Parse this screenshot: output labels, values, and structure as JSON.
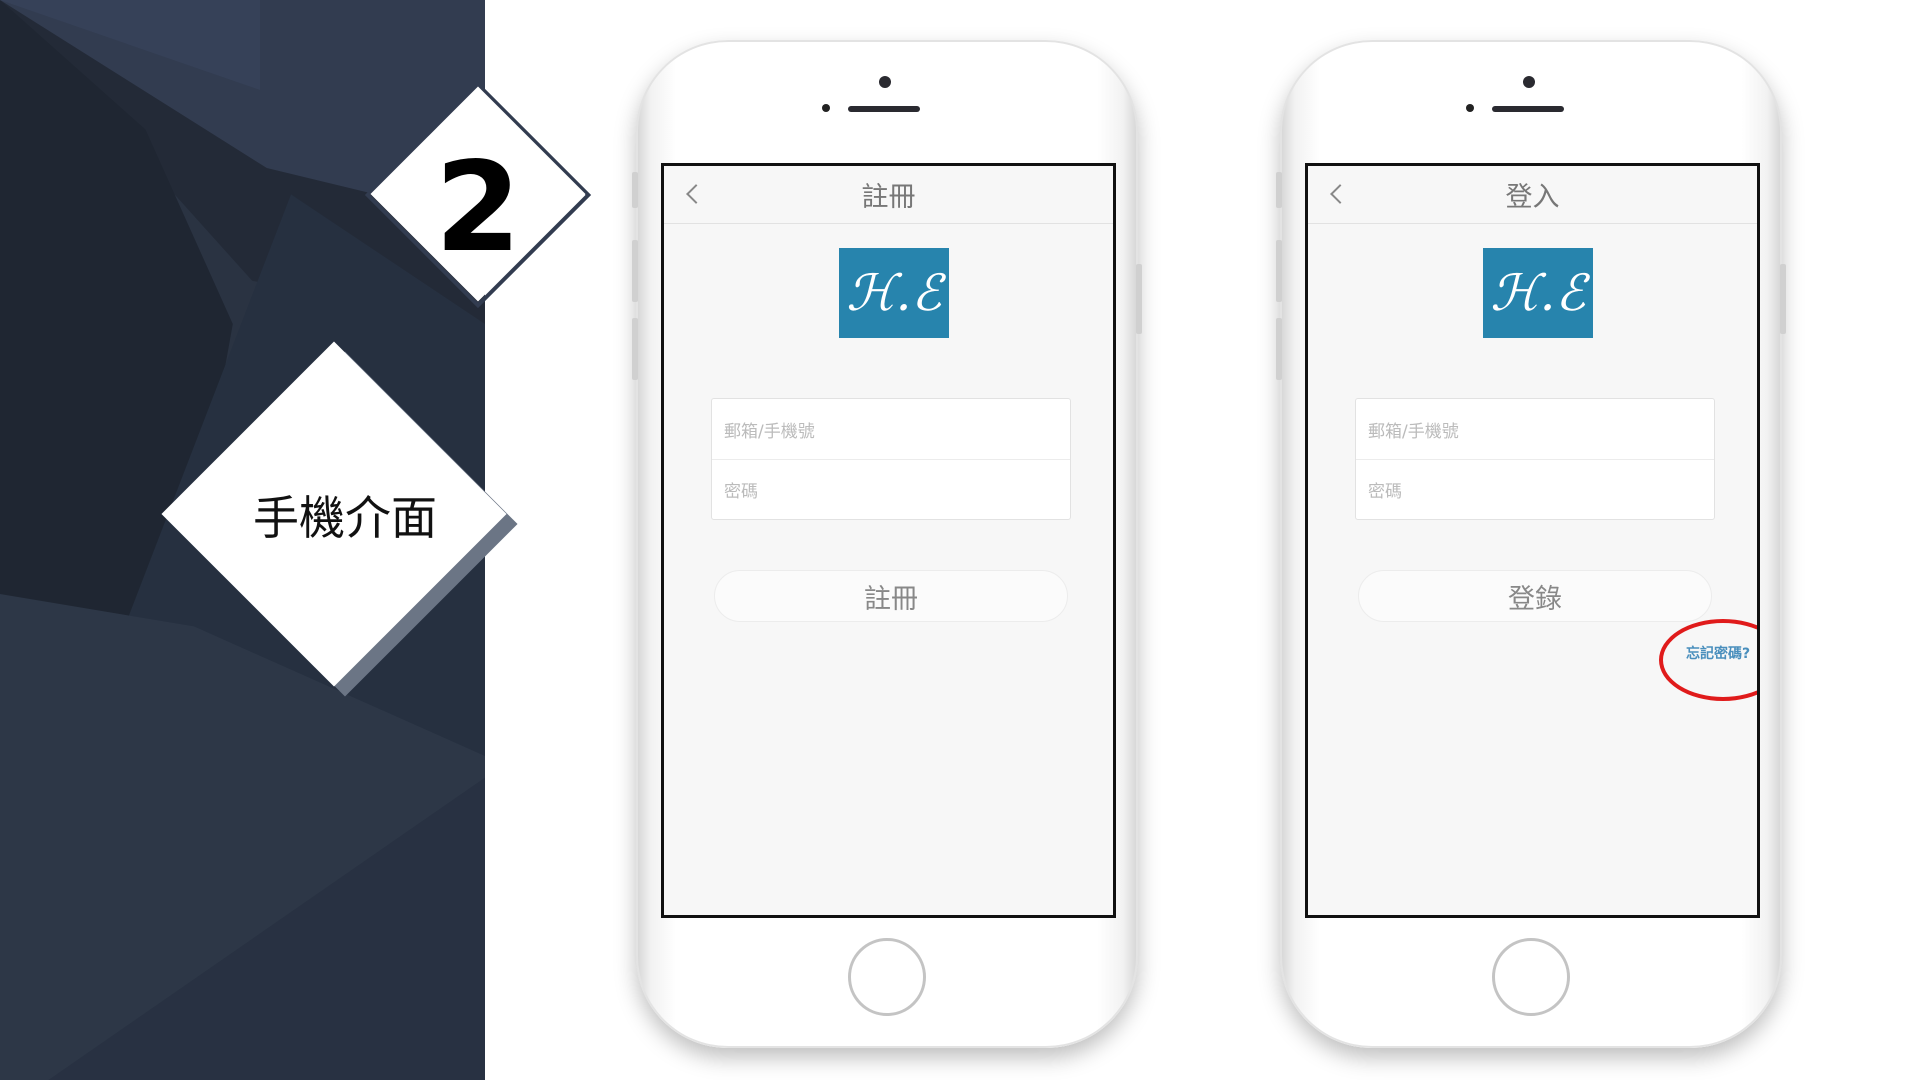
{
  "slide": {
    "step_number": "2",
    "section_label": "手機介面"
  },
  "phones": [
    {
      "title": "註冊",
      "logo_text": "ℋ.ℰ",
      "email_placeholder": "郵箱/手機號",
      "password_placeholder": "密碼",
      "button_label": "註冊"
    },
    {
      "title": "登入",
      "logo_text": "ℋ.ℰ",
      "email_placeholder": "郵箱/手機號",
      "password_placeholder": "密碼",
      "button_label": "登錄",
      "forgot_label": "忘記密碼?"
    }
  ],
  "colors": {
    "sidebar_dark": "#232a37",
    "logo_blue": "#2784ad",
    "forgot_link": "#4a8fbd",
    "highlight_circle": "#e01b1b"
  }
}
